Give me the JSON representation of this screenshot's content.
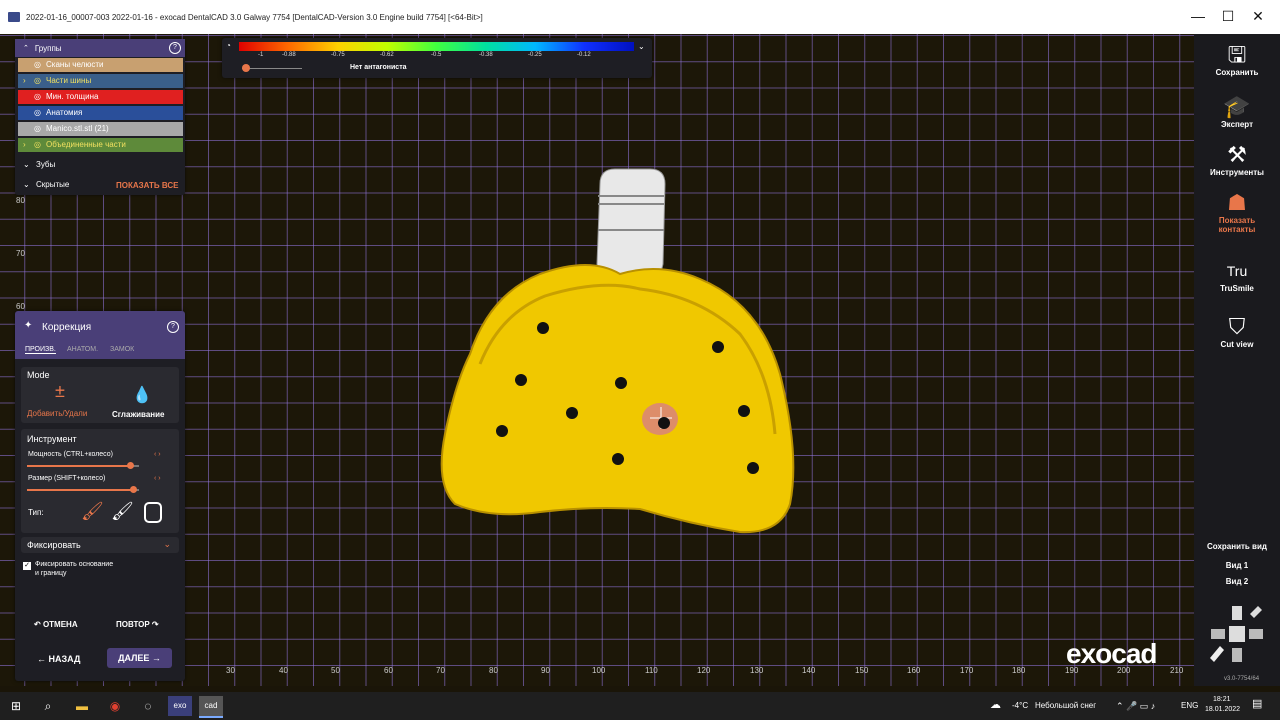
{
  "window": {
    "title": "2022-01-16_00007-003 2022-01-16 - exocad DentalCAD 3.0 Galway 7754 [DentalCAD-Version 3.0 Engine build 7754] [<64-Bit>]",
    "minimize": "—",
    "maximize": "☐",
    "close": "✕"
  },
  "groups": {
    "title": "Группы",
    "help": "?",
    "items": [
      {
        "label": "Сканы челюсти",
        "color": "#c8a070",
        "text_color": "#ffffff"
      },
      {
        "label": "Части шины",
        "color": "#3a5f8a",
        "text_color": "#f0e060",
        "expandable": true
      },
      {
        "label": "Мин. толщина",
        "color": "#e02020",
        "text_color": "#ffffff"
      },
      {
        "label": "Анатомия",
        "color": "#2a4f9a",
        "text_color": "#ffffff"
      },
      {
        "label": "Manico.stl.stl (21)",
        "color": "#a8a8a8",
        "text_color": "#ffffff"
      },
      {
        "label": "Объединенные части",
        "color": "#5e8a3a",
        "text_color": "#f0e060",
        "expandable": true
      }
    ],
    "teeth": "Зубы",
    "hidden": "Скрытые",
    "show_all": "ПОКАЗАТЬ ВСЕ"
  },
  "legend": {
    "ticks": [
      "-1",
      "-0.88",
      "-0.75",
      "-0.62",
      "-0.5",
      "-0.38",
      "-0.25",
      "-0.12"
    ],
    "no_antagonist": "Нет антагониста"
  },
  "axis_x": [
    "30",
    "40",
    "50",
    "60",
    "70",
    "80",
    "90",
    "100",
    "110",
    "120",
    "130",
    "140",
    "150",
    "160",
    "170",
    "180",
    "190",
    "200",
    "210"
  ],
  "axis_y": [
    "80",
    "70",
    "60"
  ],
  "correction": {
    "title": "Коррекция",
    "help": "?",
    "tabs": [
      "ПРОИЗВ.",
      "АНАТОМ.",
      "ЗАМОК"
    ],
    "mode_label": "Mode",
    "mode_add": "Добавить/Удали",
    "mode_smooth": "Сглаживание",
    "tool_label": "Инструмент",
    "power_label": "Мощность (CTRL+колесо)",
    "power_value": 0.9,
    "size_label": "Размер (SHIFT+колесо)",
    "size_value": 0.93,
    "type_label": "Тип:",
    "fix_label": "Фиксировать",
    "fix_check_line1": "Фиксировать основание",
    "fix_check_line2": "и границу",
    "undo": "ОТМЕНА",
    "redo": "ПОВТОР",
    "back": "НАЗАД",
    "next": "ДАЛЕЕ"
  },
  "right_toolbar": {
    "items": [
      {
        "label": "Сохранить",
        "icon": "save-icon"
      },
      {
        "label": "Эксперт",
        "icon": "graduation-cap-icon"
      },
      {
        "label": "Инструменты",
        "icon": "tools-icon"
      },
      {
        "label": "Показать контакты",
        "icon": "contacts-icon",
        "active": true
      },
      {
        "label": "TruSmile",
        "icon": "trusmile-icon"
      },
      {
        "label": "Cut view",
        "icon": "cut-view-icon"
      }
    ],
    "save_view": "Сохранить вид",
    "view1": "Вид 1",
    "view2": "Вид 2",
    "version": "v3.0-7754/64"
  },
  "brand": "exocad",
  "taskbar": {
    "temp": "-4°C",
    "weather": "Небольшой снег",
    "lang": "ENG",
    "time": "18:21",
    "date": "18.01.2022"
  },
  "colors": {
    "accent": "#e8764a",
    "panel_header": "#4a3f78",
    "model": "#f0c800"
  }
}
